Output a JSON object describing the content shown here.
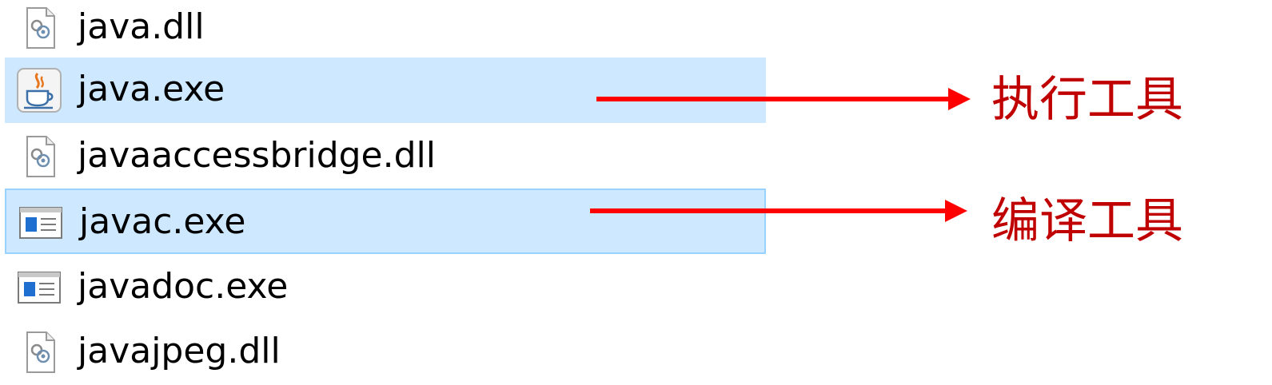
{
  "files": [
    {
      "name": "java.dll",
      "icon": "dll-file-icon",
      "selected": false
    },
    {
      "name": "java.exe",
      "icon": "java-coffee-cup-icon",
      "selected": true
    },
    {
      "name": "javaaccessbridge.dll",
      "icon": "dll-file-icon",
      "selected": false
    },
    {
      "name": "javac.exe",
      "icon": "application-window-icon",
      "selected": true
    },
    {
      "name": "javadoc.exe",
      "icon": "application-window-icon",
      "selected": false
    },
    {
      "name": "javajpeg.dll",
      "icon": "dll-file-icon",
      "selected": false
    }
  ],
  "annotations": {
    "execute_label": "执行工具",
    "compile_label": "编译工具"
  },
  "colors": {
    "selection": "#cde8ff",
    "selection_border": "#99d1ff",
    "arrow": "#ff0000",
    "annotation_text": "#c00000"
  }
}
